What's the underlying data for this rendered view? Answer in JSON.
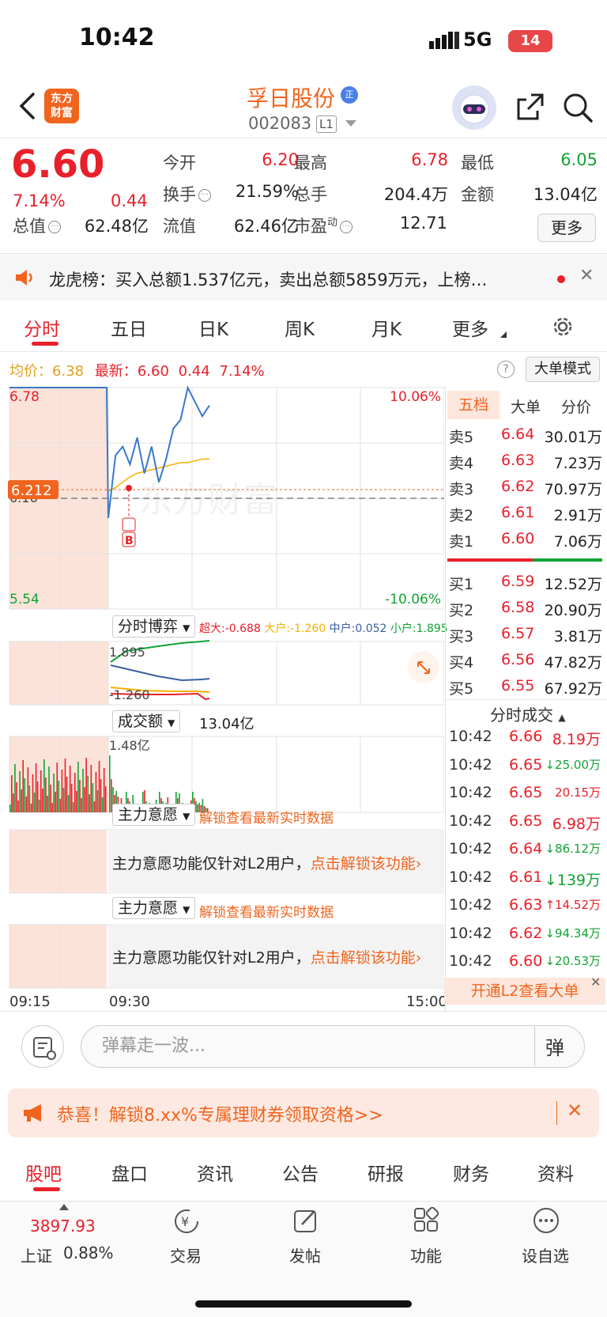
{
  "status": {
    "time": "10:42",
    "network": "5G",
    "battery": "14"
  },
  "header": {
    "logo": [
      "东方",
      "财富"
    ],
    "stock_name": "孚日股份",
    "badge": "正",
    "code": "002083",
    "level": "L1"
  },
  "quote": {
    "price": "6.60",
    "change_pct": "7.14%",
    "change": "0.44",
    "fields": [
      {
        "label": "今开",
        "value": "6.20",
        "color": "red"
      },
      {
        "label": "最高",
        "value": "6.78",
        "color": "red"
      },
      {
        "label": "最低",
        "value": "6.05",
        "color": "green"
      },
      {
        "label": "换手",
        "value": "21.59%",
        "color": "normal"
      },
      {
        "label": "总手",
        "value": "204.4万",
        "color": "normal"
      },
      {
        "label": "金额",
        "value": "13.04亿",
        "color": "normal"
      },
      {
        "label": "总值",
        "value": "62.48亿",
        "color": "normal"
      },
      {
        "label": "流值",
        "value": "62.46亿",
        "color": "normal"
      },
      {
        "label": "市盈",
        "label_sup": "动",
        "value": "12.71",
        "color": "normal"
      }
    ],
    "more_label": "更多"
  },
  "notice": {
    "text": "龙虎榜：买入总额1.537亿元，卖出总额5859万元，上榜…"
  },
  "chart_tabs": [
    "分时",
    "五日",
    "日K",
    "周K",
    "月K",
    "更多"
  ],
  "chart_info": {
    "avg_label": "均价：",
    "avg": "6.38",
    "latest_label": "最新：",
    "latest": "6.60",
    "chg": "0.44",
    "pct": "7.14%",
    "mode_button": "大单模式"
  },
  "intraday": {
    "y_top": "6.78",
    "y_mid": "6.16",
    "y_bottom": "5.54",
    "pct_top": "10.06%",
    "pct_bottom": "-10.06%",
    "marker_price": "6.212",
    "buy_marker": "B",
    "x_labels": [
      "09:15",
      "09:30",
      "15:00"
    ],
    "watermark": "东方财富"
  },
  "chart_data": {
    "type": "line",
    "title": "",
    "x": [
      "09:15",
      "09:30",
      "15:00"
    ],
    "series": [
      {
        "name": "",
        "values": [
          6.78,
          6.78,
          6.05,
          6.4,
          6.45,
          6.35,
          6.5,
          6.3,
          6.45,
          6.25,
          6.38,
          6.55,
          6.6,
          6.78,
          6.7,
          6.62,
          6.68
        ]
      },
      {
        "name": "均价",
        "values": [
          6.2,
          6.22,
          6.25,
          6.28,
          6.3,
          6.31,
          6.32,
          6.33,
          6.34,
          6.35,
          6.36,
          6.36,
          6.37,
          6.38,
          6.38
        ]
      }
    ],
    "ylim": [
      5.54,
      6.78
    ]
  },
  "ind1": {
    "label": "分时博弈",
    "super": "超大:-0.688",
    "big": "大户:-1.260",
    "mid": "中户:0.052",
    "small": "小户:1.895",
    "y_top": "1.895",
    "y_bottom": "-1.260"
  },
  "ind2": {
    "label": "成交额",
    "value": "13.04亿",
    "y_top": "1.48亿"
  },
  "ind3": {
    "label": "主力意愿",
    "unlock": "解锁查看最新实时数据",
    "msg": "主力意愿功能仅针对L2用户，",
    "link": "点击解锁该功能"
  },
  "ind4": {
    "label": "主力意愿",
    "unlock": "解锁查看最新实时数据",
    "msg": "主力意愿功能仅针对L2用户，",
    "link": "点击解锁该功能"
  },
  "orderbook": {
    "tabs": [
      "五档",
      "大单",
      "分价"
    ],
    "asks": [
      {
        "label": "卖5",
        "price": "6.64",
        "vol": "30.01万"
      },
      {
        "label": "卖4",
        "price": "6.63",
        "vol": "7.23万"
      },
      {
        "label": "卖3",
        "price": "6.62",
        "vol": "70.97万"
      },
      {
        "label": "卖2",
        "price": "6.61",
        "vol": "2.91万"
      },
      {
        "label": "卖1",
        "price": "6.60",
        "vol": "7.06万"
      }
    ],
    "bids": [
      {
        "label": "买1",
        "price": "6.59",
        "vol": "12.52万"
      },
      {
        "label": "买2",
        "price": "6.58",
        "vol": "20.90万"
      },
      {
        "label": "买3",
        "price": "6.57",
        "vol": "3.81万"
      },
      {
        "label": "买4",
        "price": "6.56",
        "vol": "47.82万"
      },
      {
        "label": "买5",
        "price": "6.55",
        "vol": "67.92万"
      }
    ]
  },
  "ticks": {
    "title": "分时成交",
    "rows": [
      {
        "time": "10:42",
        "price": "6.66",
        "vol": "8.19万",
        "dir": "",
        "color": "red"
      },
      {
        "time": "10:42",
        "price": "6.65",
        "vol": "25.00万",
        "dir": "↓",
        "color": "green"
      },
      {
        "time": "10:42",
        "price": "6.65",
        "vol": "20.15万",
        "dir": "",
        "color": "red"
      },
      {
        "time": "10:42",
        "price": "6.65",
        "vol": "6.98万",
        "dir": "",
        "color": "red"
      },
      {
        "time": "10:42",
        "price": "6.64",
        "vol": "86.12万",
        "dir": "↓",
        "color": "green"
      },
      {
        "time": "10:42",
        "price": "6.61",
        "vol": "139万",
        "dir": "↓",
        "color": "green"
      },
      {
        "time": "10:42",
        "price": "6.63",
        "vol": "14.52万",
        "dir": "↑",
        "color": "red"
      },
      {
        "time": "10:42",
        "price": "6.62",
        "vol": "94.34万",
        "dir": "↓",
        "color": "green"
      },
      {
        "time": "10:42",
        "price": "6.60",
        "vol": "20.53万",
        "dir": "↓",
        "color": "green"
      }
    ],
    "l2_promo": "开通L2查看大单"
  },
  "danmu": {
    "placeholder": "弹幕走一波...",
    "button": "弹"
  },
  "promo": {
    "text": "恭喜！解锁8.xx%专属理财券领取资格>>"
  },
  "bottom_tabs": [
    "股吧",
    "盘口",
    "资讯",
    "公告",
    "研报",
    "财务",
    "资料"
  ],
  "bottom_nav": {
    "index_value": "3897.93",
    "index_name": "上证",
    "index_pct": "0.88%",
    "items": [
      "交易",
      "发帖",
      "功能",
      "设自选"
    ]
  },
  "colors": {
    "red": "#e8202a",
    "green": "#12a334",
    "orange": "#f0641e"
  }
}
